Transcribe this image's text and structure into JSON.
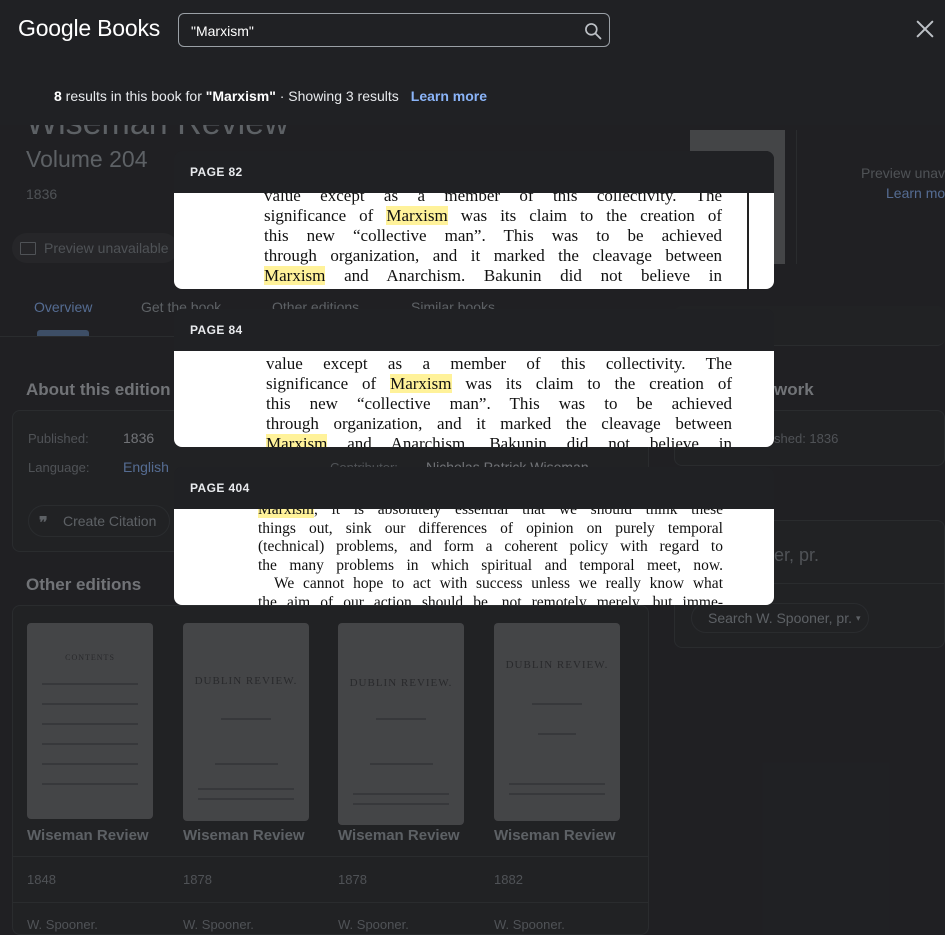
{
  "header": {
    "logo": "Google Books",
    "search_value": "\"Marxism\"",
    "close_icon": "close-icon",
    "search_icon": "search-icon"
  },
  "summary": {
    "count": "8",
    "mid": " results in this book for ",
    "query": "\"Marxism\"",
    "showing": " · Showing 3 results",
    "learn_more": "Learn more"
  },
  "results": [
    {
      "page": "PAGE 82",
      "lines": [
        [
          "value except as a member of this collectivity. The",
          "",
          ""
        ],
        [
          "significance of ",
          "Marxism",
          " was its claim to the creation of"
        ],
        [
          "this new “collective man”. This was to be achieved",
          "",
          ""
        ],
        [
          "through organization, and it marked the cleavage between",
          "",
          ""
        ],
        [
          "",
          "Marxism",
          " and Anarchism. Bakunin did not believe in"
        ]
      ]
    },
    {
      "page": "PAGE 84",
      "lines": [
        [
          "value except as a member of this collectivity. The",
          "",
          ""
        ],
        [
          "significance of ",
          "Marxism",
          " was its claim to the creation of"
        ],
        [
          "this new “collective man”. This was to be achieved",
          "",
          ""
        ],
        [
          "through organization, and it marked the cleavage between",
          "",
          ""
        ],
        [
          "",
          "Marxism",
          " and Anarchism. Bakunin did not believe in"
        ]
      ]
    },
    {
      "page": "PAGE 404",
      "lines": [
        [
          "",
          "Marxism",
          ", it is absolutely essential that we should think these"
        ],
        [
          "things out, sink our differences of opinion on purely temporal",
          "",
          ""
        ],
        [
          "(technical) problems, and form a coherent policy with regard to",
          "",
          ""
        ],
        [
          "the many problems in which spiritual and temporal meet, now.",
          "",
          ""
        ],
        [
          "We cannot hope to act with success unless we really know what",
          "",
          ""
        ],
        [
          "the aim of our action should be, not remotely merely, but imme-",
          "",
          ""
        ]
      ]
    }
  ],
  "background": {
    "title": "Wiseman Review",
    "volume": "Volume 204",
    "year": "1836",
    "preview": "Preview unavailable",
    "tabs": [
      "Overview",
      "Get the book",
      "Other editions",
      "Similar books"
    ],
    "about_title": "About this edition",
    "published_label": "Published:",
    "published_value": "1836",
    "language_label": "Language:",
    "language_value": "English",
    "contributor_label": "Contributor:",
    "contributor_value": "Nicholas Patrick Wiseman",
    "cite_label": "Create Citation",
    "cite_icon": "quote-icon",
    "other_editions_title": "Other editions",
    "editions": [
      {
        "title": "Wiseman Review",
        "year": "1848",
        "author": "W. Spooner."
      },
      {
        "title": "Wiseman Review",
        "year": "1878",
        "author": "W. Spooner."
      },
      {
        "title": "Wiseman Review",
        "year": "1878",
        "author": "W. Spooner."
      },
      {
        "title": "Wiseman Review",
        "year": "1882",
        "author": "W. Spooner."
      }
    ],
    "thumb_titles": [
      "CONTENTS",
      "DUBLIN REVIEW.",
      "DUBLIN REVIEW.",
      "DUBLIN REVIEW."
    ],
    "side_preview": "Preview unava",
    "side_learn": "Learn mo",
    "work_title": "work",
    "side_published": "shed: 1836",
    "side_author": "er, pr.",
    "side_search": "Search W. Spooner, pr."
  },
  "colors": {
    "accent": "#8ab4f8",
    "highlight": "#fff29a",
    "background": "#202124"
  }
}
